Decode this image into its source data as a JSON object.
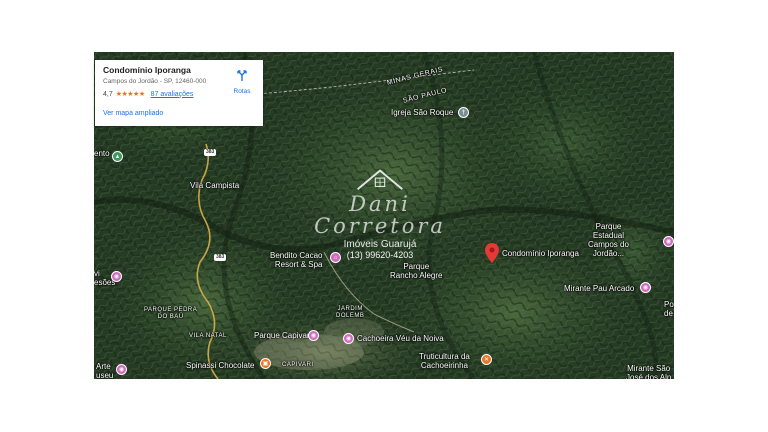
{
  "infocard": {
    "title": "Condomínio Iporanga",
    "address": "Campos do Jordão - SP, 12460-000",
    "rating": "4,7",
    "stars": "★★★★★",
    "reviews": "87 avaliações",
    "bigger_map": "Ver mapa ampliado",
    "routes_label": "Rotas"
  },
  "watermark": {
    "line1": "Dani",
    "line2": "Corretora",
    "line3": "Imóveis Guarujá",
    "phone": "(13) 99620-4203"
  },
  "labels": {
    "minas_gerais": "MINAS GERAIS",
    "sao_paulo": "SÃO PAULO",
    "igreja": "Igreja São Roque",
    "vila_campista": "Vila Campista",
    "bendito_cacao": "Bendito Cacao\nResort & Spa",
    "parque_rancho": "Parque\nRancho Alegre",
    "condominio": "Condomínio Iporanga",
    "parque_estadual": "Parque\nEstadual\nCampos do\nJordão...",
    "mirante_pau": "Mirante Pau Arcado",
    "parque_pedra": "PARQUE PEDRA\nDO BAÚ",
    "vila_natal": "VILA NATAL",
    "parque_capivari": "Parque Capivari",
    "jardim": "JARDIM\nDOLEMB",
    "cachoeira": "Cachoeira Véu da Noiva",
    "spinassi": "Spinassi Chocolate",
    "capivari": "CAPIVARI",
    "truticultura": "Truticultura da\nCachoeirinha",
    "mirante_sao_jose": "Mirante São\nJosé dos Alp",
    "arte_museu": "Arte\nuseu",
    "pessoes": "vi\nesões",
    "ento": "ento",
    "po": "Po\nde",
    "road_383a": "383",
    "road_383b": "383"
  },
  "colors": {
    "marker_red": "#e53935",
    "poi_pink": "#d06bbd",
    "poi_orange": "#e8762b",
    "poi_teal": "#3b8f8f",
    "poi_green": "#3a9a5c",
    "link_blue": "#1a73e8",
    "star_orange": "#e7711b"
  }
}
